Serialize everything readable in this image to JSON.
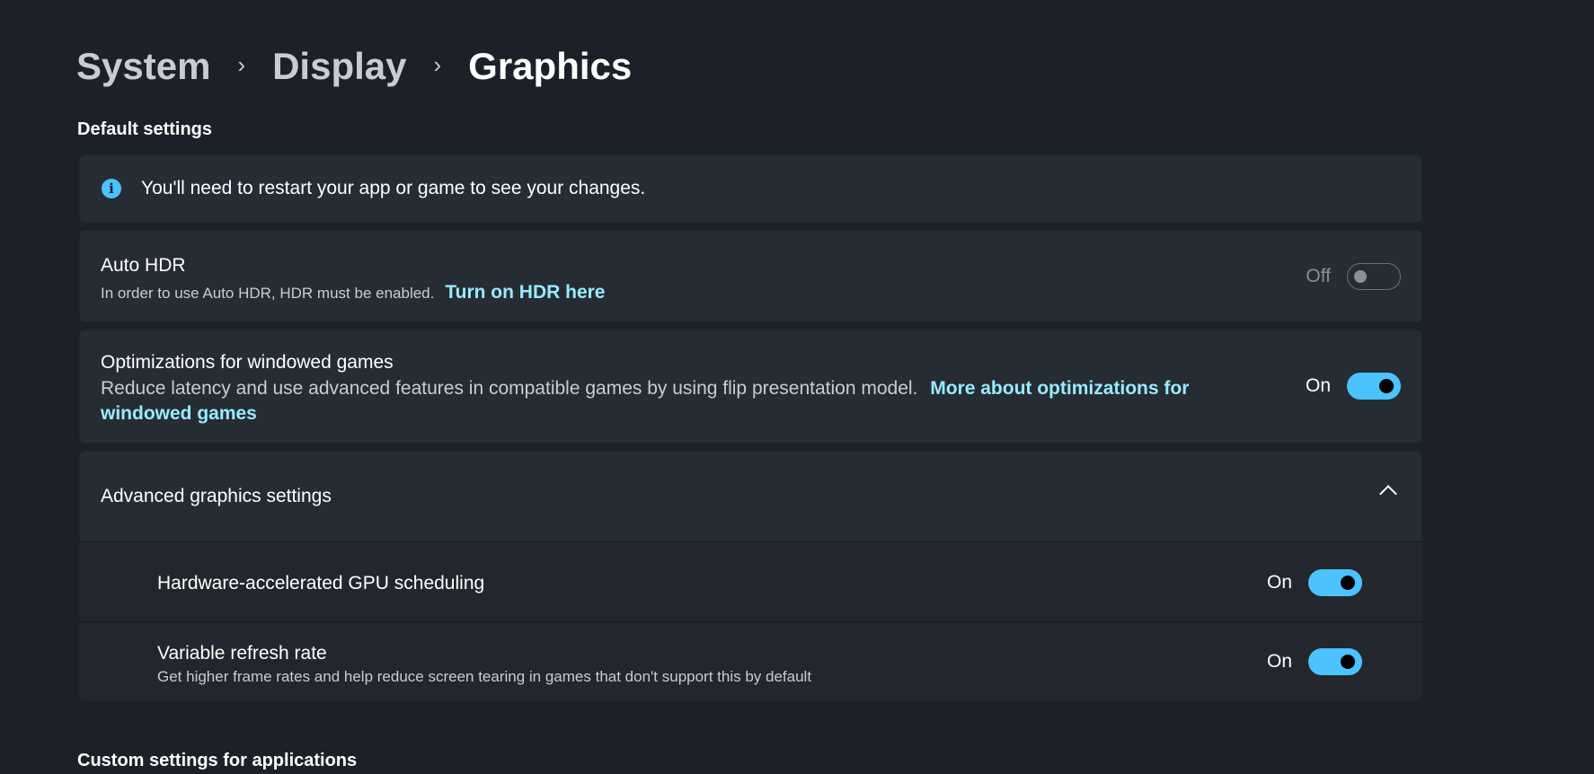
{
  "breadcrumb": {
    "items": [
      "System",
      "Display",
      "Graphics"
    ],
    "separator": "›"
  },
  "default_settings": {
    "title": "Default settings",
    "info": {
      "icon": "info-icon",
      "text": "You'll need to restart your app or game to see your changes."
    },
    "auto_hdr": {
      "title": "Auto HDR",
      "description": "In order to use Auto HDR, HDR must be enabled.",
      "link": "Turn on HDR here",
      "state_label": "Off",
      "enabled": false
    },
    "windowed_games": {
      "title": "Optimizations for windowed games",
      "description": "Reduce latency and use advanced features in compatible games by using flip presentation model.",
      "link": "More about optimizations for windowed games",
      "state_label": "On",
      "enabled": true
    },
    "advanced": {
      "title": "Advanced graphics settings",
      "expanded": true,
      "items": [
        {
          "title": "Hardware-accelerated GPU scheduling",
          "description": "",
          "state_label": "On",
          "enabled": true
        },
        {
          "title": "Variable refresh rate",
          "description": "Get higher frame rates and help reduce screen tearing in games that don't support this by default",
          "state_label": "On",
          "enabled": true
        }
      ]
    }
  },
  "custom_settings": {
    "title": "Custom settings for applications"
  },
  "colors": {
    "background": "#1c2128",
    "card": "#262c34",
    "accent": "#4cc2ff",
    "link": "#99ebff"
  }
}
